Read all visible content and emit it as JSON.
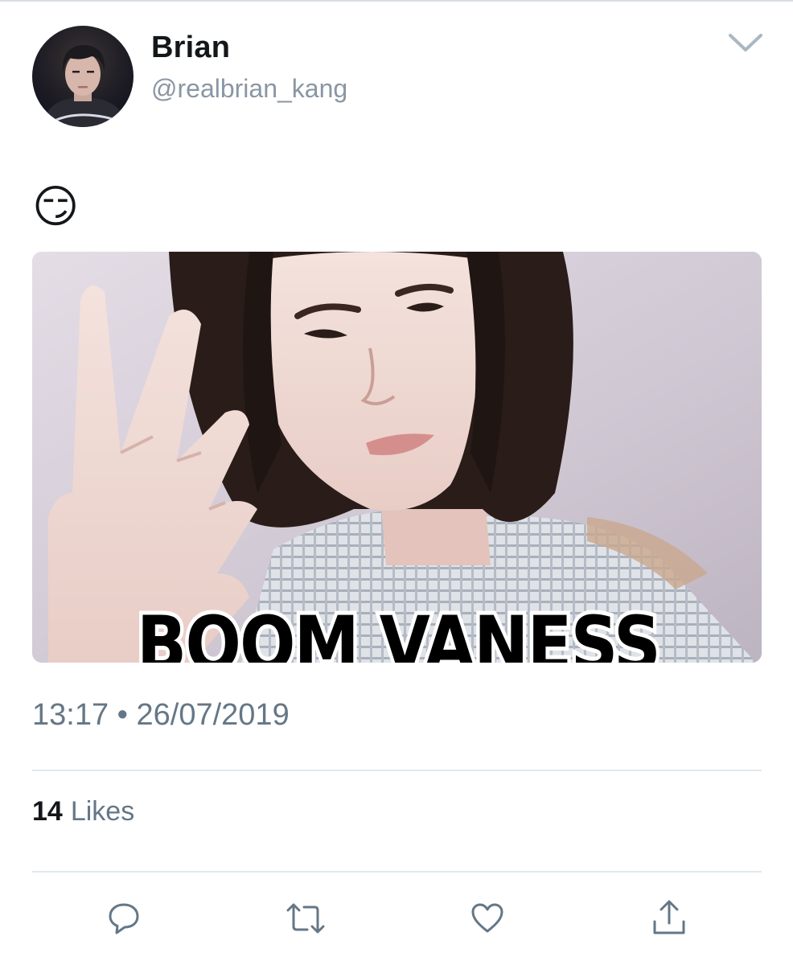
{
  "user": {
    "display_name": "Brian",
    "handle": "@realbrian_kang"
  },
  "tweet": {
    "text": "😏",
    "media_caption": "BOOM VANESS",
    "timestamp": "13:17 • 26/07/2019"
  },
  "stats": {
    "likes_count": "14",
    "likes_label": "Likes"
  },
  "icons": {
    "caret": "chevron-down-icon",
    "reply": "reply-icon",
    "retweet": "retweet-icon",
    "like": "heart-icon",
    "share": "share-icon"
  },
  "colors": {
    "text_primary": "#14171a",
    "text_secondary": "#657786",
    "icon": "#657786",
    "divider": "#e1e8ed"
  }
}
